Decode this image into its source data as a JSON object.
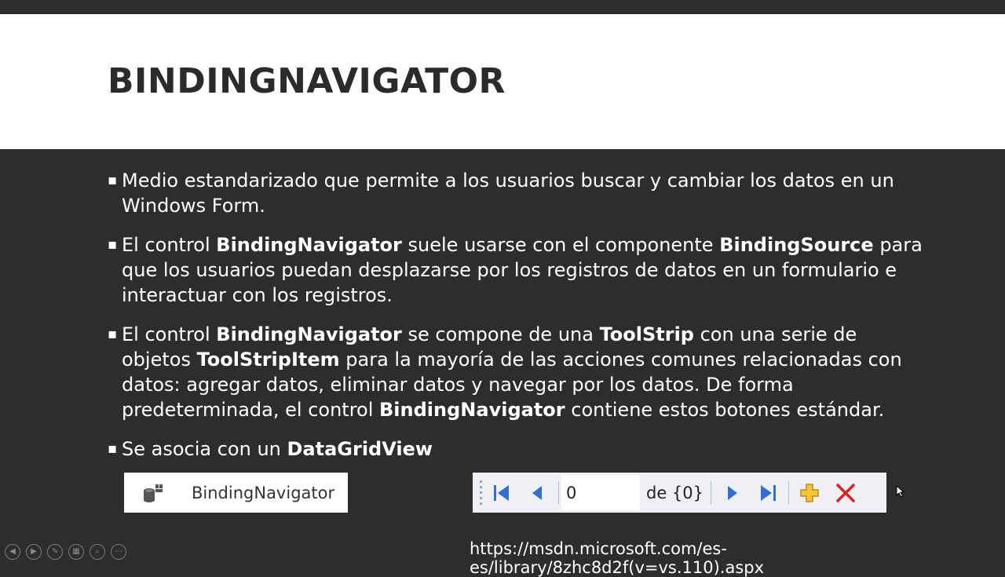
{
  "title": "BINDINGNAVIGATOR",
  "bullets": {
    "b1": {
      "t1": "Medio estandarizado que permite a los usuarios buscar y cambiar los datos en un Windows Form."
    },
    "b2": {
      "t1": "El control ",
      "b1": "BindingNavigator",
      "t2": " suele usarse con el componente ",
      "b2": "BindingSource",
      "t3": " para que los usuarios puedan desplazarse por los registros de datos en un formulario e interactuar con los registros."
    },
    "b3": {
      "t1": "El control ",
      "b1": "BindingNavigator",
      "t2": " se compone de una ",
      "b2": "ToolStrip",
      "t3": " con una serie de objetos ",
      "b3": "ToolStripItem",
      "t4": " para la mayoría de las acciones comunes relacionadas con datos: agregar datos, eliminar datos y navegar por los datos. De forma predeterminada, el control ",
      "b4": "BindingNavigator",
      "t5": " contiene estos botones estándar."
    },
    "b4": {
      "t1": "Se asocia con un ",
      "b1": "DataGridView"
    }
  },
  "component": {
    "label": "BindingNavigator",
    "icon": "database-component-icon"
  },
  "navigator": {
    "position_value": "0",
    "count_label": "de {0}",
    "icons": [
      "move-first-icon",
      "move-previous-icon",
      "move-next-icon",
      "move-last-icon",
      "add-new-icon",
      "delete-icon"
    ],
    "colors": {
      "nav_blue": "#2f6fd6",
      "add_yellow": "#e8b21a",
      "delete_red": "#e02020"
    }
  },
  "url": "https://msdn.microsoft.com/es-es/library/8zhc8d2f(v=vs.110).aspx"
}
